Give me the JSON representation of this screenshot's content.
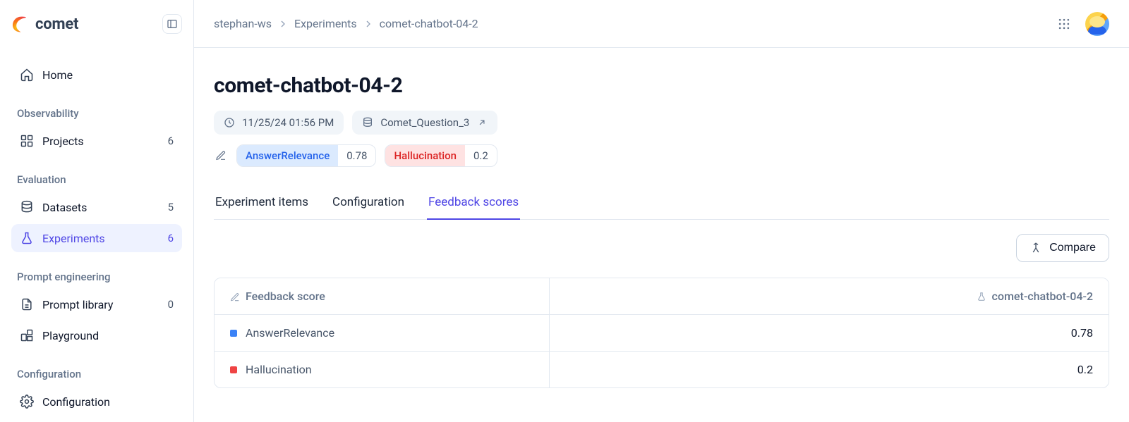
{
  "brand": {
    "name": "comet"
  },
  "sidebar": {
    "home_label": "Home",
    "sections": {
      "observability": "Observability",
      "evaluation": "Evaluation",
      "prompt_eng": "Prompt engineering",
      "configuration": "Configuration"
    },
    "projects": {
      "label": "Projects",
      "count": "6"
    },
    "datasets": {
      "label": "Datasets",
      "count": "5"
    },
    "experiments": {
      "label": "Experiments",
      "count": "6"
    },
    "promptlib": {
      "label": "Prompt library",
      "count": "0"
    },
    "playground": {
      "label": "Playground"
    },
    "config": {
      "label": "Configuration"
    }
  },
  "breadcrumbs": {
    "items": [
      "stephan-ws",
      "Experiments",
      "comet-chatbot-04-2"
    ]
  },
  "page": {
    "title": "comet-chatbot-04-2",
    "datetime": "11/25/24 01:56 PM",
    "dataset_chip": "Comet_Question_3"
  },
  "scores": {
    "answer_relevance": {
      "label": "AnswerRelevance",
      "value": "0.78"
    },
    "hallucination": {
      "label": "Hallucination",
      "value": "0.2"
    }
  },
  "tabs": {
    "items": "Experiment items",
    "config": "Configuration",
    "feedback": "Feedback scores"
  },
  "actions": {
    "compare": "Compare"
  },
  "table": {
    "headers": {
      "feedback": "Feedback score",
      "exp_col": "comet-chatbot-04-2"
    },
    "rows": [
      {
        "name": "AnswerRelevance",
        "value": "0.78",
        "color": "blue"
      },
      {
        "name": "Hallucination",
        "value": "0.2",
        "color": "red"
      }
    ]
  }
}
